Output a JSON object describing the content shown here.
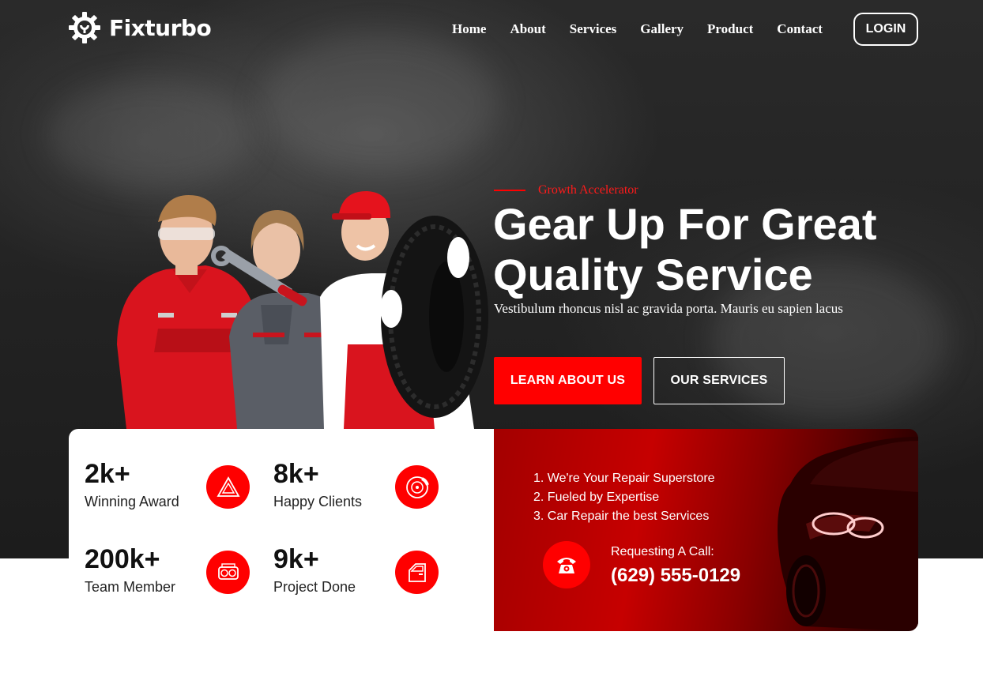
{
  "header": {
    "logo_text": "Fixturbo",
    "logo_icon": "gear-wrench-icon",
    "nav": [
      "Home",
      "About",
      "Services",
      "Gallery",
      "Product",
      "Contact"
    ],
    "login_label": "LOGIN"
  },
  "hero": {
    "eyebrow": "Growth Accelerator",
    "headline_line1": "Gear Up For Great",
    "headline_line2": "Quality Service",
    "subtext": "Vestibulum rhoncus nisl ac gravida porta. Mauris eu sapien lacus",
    "primary_button": "LEARN ABOUT US",
    "secondary_button": "OUR SERVICES"
  },
  "stats": [
    {
      "value": "2k+",
      "label": "Winning Award",
      "icon": "warning-triangle-icon"
    },
    {
      "value": "8k+",
      "label": "Happy Clients",
      "icon": "brake-disc-icon"
    },
    {
      "value": "200k+",
      "label": "Team Member",
      "icon": "engine-icon"
    },
    {
      "value": "9k+",
      "label": "Project Done",
      "icon": "car-door-icon"
    }
  ],
  "callout": {
    "features": [
      "1. We're Your Repair Superstore",
      "2. Fueled by Expertise",
      "3. Car Repair the best Services"
    ],
    "call_label": "Requesting A Call:",
    "phone": "(629) 555-0129",
    "phone_icon": "telephone-icon"
  },
  "colors": {
    "accent": "#ff0000",
    "dark": "#222222",
    "card_red": "#b30000"
  }
}
